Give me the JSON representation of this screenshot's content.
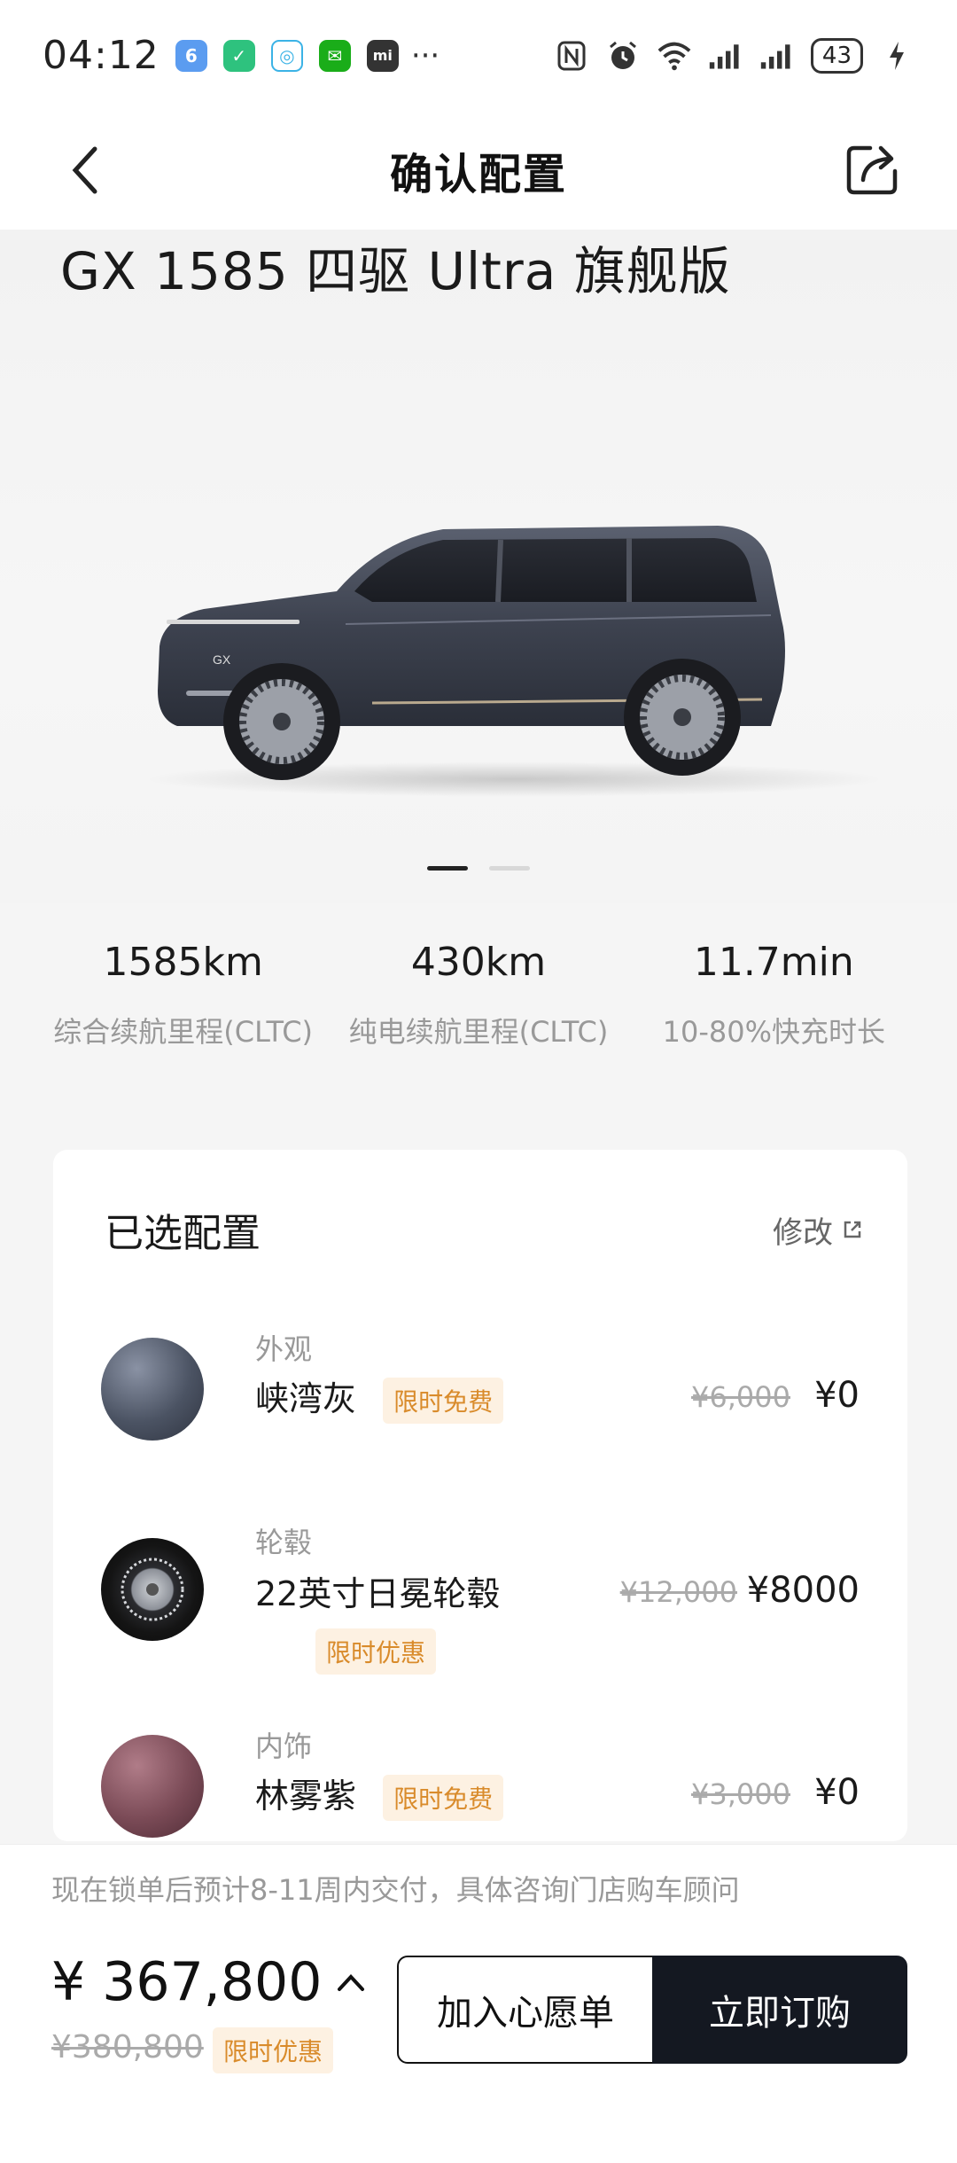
{
  "status_bar": {
    "time": "04:12",
    "battery": "43",
    "more": "···",
    "app_icons": [
      {
        "name": "app-icon-blue",
        "color": "#5b9cf0",
        "glyph": "6"
      },
      {
        "name": "app-icon-green-mi",
        "color": "#2ec27e",
        "glyph": "✓"
      },
      {
        "name": "app-icon-chat-bubble",
        "color": "#3bb3e6",
        "glyph": "◎"
      },
      {
        "name": "wechat-icon",
        "color": "#1aad19",
        "glyph": "✉"
      },
      {
        "name": "mi-icon",
        "color": "#333333",
        "glyph": "mi"
      }
    ]
  },
  "nav": {
    "title": "确认配置"
  },
  "hero": {
    "car_title": "GX 1585 四驱 Ultra 旗舰版",
    "car_badge": "GX",
    "carousel_index": 0,
    "carousel_count": 2
  },
  "specs": [
    {
      "value": "1585km",
      "label": "综合续航里程(CLTC)"
    },
    {
      "value": "430km",
      "label": "纯电续航里程(CLTC)"
    },
    {
      "value": "11.7min",
      "label": "10-80%快充时长"
    }
  ],
  "config": {
    "title": "已选配置",
    "edit_label": "修改",
    "items": [
      {
        "category": "外观",
        "name": "峡湾灰",
        "badge": "限时免费",
        "old_price": "¥6,000",
        "price": "¥0",
        "swatch": "#4b5363"
      },
      {
        "category": "轮毂",
        "name": "22英寸日冕轮毂",
        "badge": "限时优惠",
        "old_price": "¥12,000",
        "price": "¥8000",
        "swatch": "#1c1c1c"
      },
      {
        "category": "内饰",
        "name": "林雾紫",
        "badge": "限时免费",
        "old_price": "¥3,000",
        "price": "¥0",
        "swatch": "#7a4a56"
      }
    ]
  },
  "bottom": {
    "delivery_note": "现在锁单后预计8-11周内交付，具体咨询门店购车顾问",
    "price": "¥ 367,800",
    "old_price": "¥380,800",
    "price_badge": "限时优惠",
    "wishlist_label": "加入心愿单",
    "buy_label": "立即订购"
  },
  "colors": {
    "accent_dark": "#141821",
    "badge_bg": "#fdf1e2",
    "badge_text": "#d98b2b"
  }
}
